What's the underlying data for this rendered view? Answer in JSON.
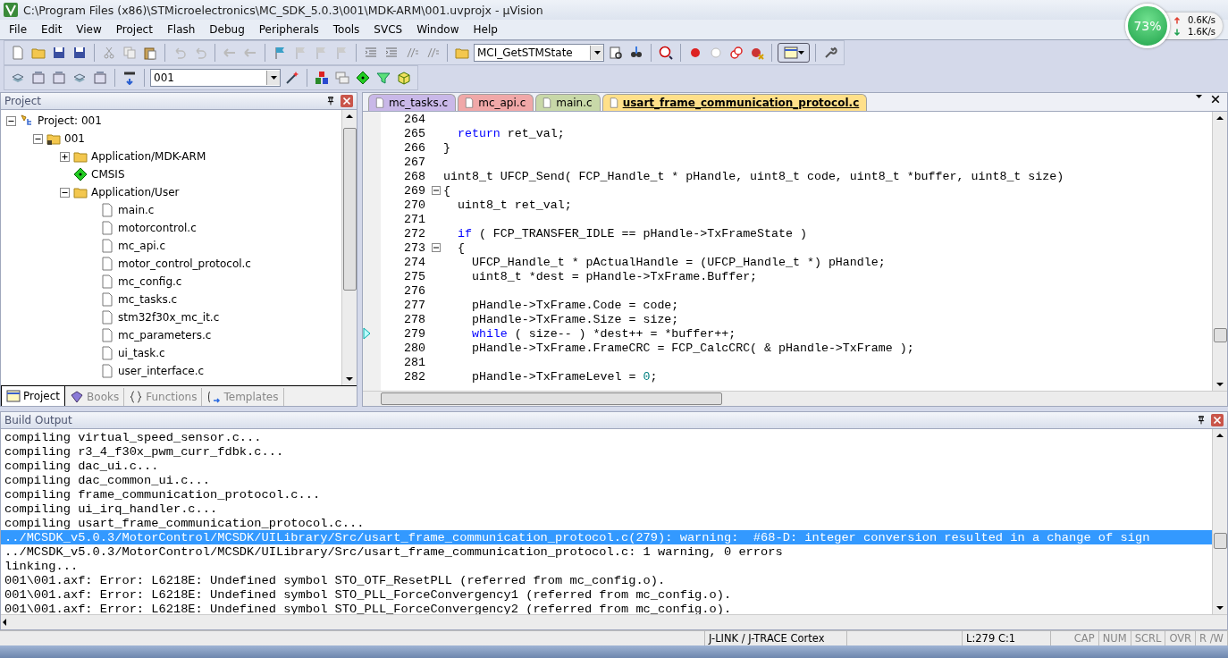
{
  "window": {
    "title": "C:\\Program Files (x86)\\STMicroelectronics\\MC_SDK_5.0.3\\001\\MDK-ARM\\001.uvprojx - µVision"
  },
  "net_monitor": {
    "cpu": "73%",
    "upload": "0.6K/s",
    "download": "1.6K/s"
  },
  "menu": [
    "File",
    "Edit",
    "View",
    "Project",
    "Flash",
    "Debug",
    "Peripherals",
    "Tools",
    "SVCS",
    "Window",
    "Help"
  ],
  "toolbar": {
    "function_combo": "MCI_GetSTMState",
    "target_combo": "001"
  },
  "project_panel": {
    "title": "Project",
    "tree": [
      {
        "label": "Project: 001",
        "kind": "project",
        "expanded": true,
        "children": [
          {
            "label": "001",
            "kind": "target",
            "expanded": true,
            "children": [
              {
                "label": "Application/MDK-ARM",
                "kind": "folder",
                "expanded": false
              },
              {
                "label": "CMSIS",
                "kind": "component"
              },
              {
                "label": "Application/User",
                "kind": "folder",
                "expanded": true,
                "children": [
                  {
                    "label": "main.c",
                    "kind": "file"
                  },
                  {
                    "label": "motorcontrol.c",
                    "kind": "file"
                  },
                  {
                    "label": "mc_api.c",
                    "kind": "file"
                  },
                  {
                    "label": "motor_control_protocol.c",
                    "kind": "file"
                  },
                  {
                    "label": "mc_config.c",
                    "kind": "file"
                  },
                  {
                    "label": "mc_tasks.c",
                    "kind": "file"
                  },
                  {
                    "label": "stm32f30x_mc_it.c",
                    "kind": "file"
                  },
                  {
                    "label": "mc_parameters.c",
                    "kind": "file"
                  },
                  {
                    "label": "ui_task.c",
                    "kind": "file"
                  },
                  {
                    "label": "user_interface.c",
                    "kind": "file"
                  }
                ]
              }
            ]
          }
        ]
      }
    ],
    "tabs": [
      {
        "label": "Project",
        "kind": "project",
        "selected": true
      },
      {
        "label": "Books",
        "kind": "books",
        "selected": false
      },
      {
        "label": "Functions",
        "kind": "functions",
        "selected": false
      },
      {
        "label": "Templates",
        "kind": "templates",
        "selected": false
      }
    ]
  },
  "editor": {
    "tabs": [
      {
        "label": "mc_tasks.c",
        "color": "#c9b8e8",
        "selected": false
      },
      {
        "label": "mc_api.c",
        "color": "#f0a8a8",
        "selected": false
      },
      {
        "label": "main.c",
        "color": "#c8d8a8",
        "selected": false
      },
      {
        "label": "usart_frame_communication_protocol.c",
        "color": "#ffe08a",
        "selected": true
      }
    ],
    "lines": [
      {
        "number": "264",
        "collapsible": false,
        "current": false
      },
      {
        "number": "265",
        "collapsible": false,
        "current": false,
        "segments": [
          {
            "kind": "keyword",
            "text": "  return"
          },
          {
            "kind": "plain",
            "text": " ret_val;"
          }
        ]
      },
      {
        "number": "266",
        "collapsible": false,
        "current": false,
        "segments": [
          {
            "kind": "plain",
            "text": "}"
          }
        ]
      },
      {
        "number": "267",
        "collapsible": false,
        "current": false
      },
      {
        "number": "268",
        "collapsible": false,
        "current": false,
        "segments": [
          {
            "kind": "plain",
            "text": "uint8_t UFCP_Send( FCP_Handle_t * pHandle, uint8_t code, uint8_t *buffer, uint8_t size)"
          }
        ]
      },
      {
        "number": "269",
        "collapsible": true,
        "current": false,
        "segments": [
          {
            "kind": "plain",
            "text": "{"
          }
        ]
      },
      {
        "number": "270",
        "collapsible": false,
        "current": false,
        "segments": [
          {
            "kind": "plain",
            "text": "  uint8_t ret_val;"
          }
        ]
      },
      {
        "number": "271",
        "collapsible": false,
        "current": false
      },
      {
        "number": "272",
        "collapsible": false,
        "current": false,
        "segments": [
          {
            "kind": "keyword",
            "text": "  if"
          },
          {
            "kind": "plain",
            "text": " ( FCP_TRANSFER_IDLE == pHandle->TxFrameState )"
          }
        ]
      },
      {
        "number": "273",
        "collapsible": true,
        "current": false,
        "segments": [
          {
            "kind": "plain",
            "text": "  {"
          }
        ]
      },
      {
        "number": "274",
        "collapsible": false,
        "current": false,
        "segments": [
          {
            "kind": "plain",
            "text": "    UFCP_Handle_t * pActualHandle = (UFCP_Handle_t *) pHandle;"
          }
        ]
      },
      {
        "number": "275",
        "collapsible": false,
        "current": false,
        "segments": [
          {
            "kind": "plain",
            "text": "    uint8_t *dest = pHandle->TxFrame.Buffer;"
          }
        ]
      },
      {
        "number": "276",
        "collapsible": false,
        "current": false
      },
      {
        "number": "277",
        "collapsible": false,
        "current": false,
        "segments": [
          {
            "kind": "plain",
            "text": "    pHandle->TxFrame.Code = code;"
          }
        ]
      },
      {
        "number": "278",
        "collapsible": false,
        "current": false,
        "segments": [
          {
            "kind": "plain",
            "text": "    pHandle->TxFrame.Size = size;"
          }
        ]
      },
      {
        "number": "279",
        "collapsible": false,
        "current": true,
        "segments": [
          {
            "kind": "keyword",
            "text": "    while"
          },
          {
            "kind": "plain",
            "text": " ( size-- ) *dest++ = *buffer++;"
          }
        ]
      },
      {
        "number": "280",
        "collapsible": false,
        "current": false,
        "segments": [
          {
            "kind": "plain",
            "text": "    pHandle->TxFrame.FrameCRC = FCP_CalcCRC( & pHandle->TxFrame );"
          }
        ]
      },
      {
        "number": "281",
        "collapsible": false,
        "current": false
      },
      {
        "number": "282",
        "collapsible": false,
        "current": false,
        "segments": [
          {
            "kind": "plain",
            "text": "    pHandle->TxFrameLevel = "
          },
          {
            "kind": "number",
            "text": "0"
          },
          {
            "kind": "plain",
            "text": ";"
          }
        ]
      }
    ]
  },
  "build_output": {
    "title": "Build Output",
    "lines": [
      {
        "text": "compiling virtual_speed_sensor.c...",
        "selected": false
      },
      {
        "text": "compiling r3_4_f30x_pwm_curr_fdbk.c...",
        "selected": false
      },
      {
        "text": "compiling dac_ui.c...",
        "selected": false
      },
      {
        "text": "compiling dac_common_ui.c...",
        "selected": false
      },
      {
        "text": "compiling frame_communication_protocol.c...",
        "selected": false
      },
      {
        "text": "compiling ui_irq_handler.c...",
        "selected": false
      },
      {
        "text": "compiling usart_frame_communication_protocol.c...",
        "selected": false
      },
      {
        "text": "../MCSDK_v5.0.3/MotorControl/MCSDK/UILibrary/Src/usart_frame_communication_protocol.c(279): warning:  #68-D: integer conversion resulted in a change of sign",
        "selected": true
      },
      {
        "text": "../MCSDK_v5.0.3/MotorControl/MCSDK/UILibrary/Src/usart_frame_communication_protocol.c: 1 warning, 0 errors",
        "selected": false
      },
      {
        "text": "linking...",
        "selected": false
      },
      {
        "text": "001\\001.axf: Error: L6218E: Undefined symbol STO_OTF_ResetPLL (referred from mc_config.o).",
        "selected": false
      },
      {
        "text": "001\\001.axf: Error: L6218E: Undefined symbol STO_PLL_ForceConvergency1 (referred from mc_config.o).",
        "selected": false
      },
      {
        "text": "001\\001.axf: Error: L6218E: Undefined symbol STO_PLL_ForceConvergency2 (referred from mc_config.o).",
        "selected": false
      }
    ]
  },
  "status_bar": {
    "debugger": "J-LINK / J-TRACE Cortex",
    "position": "L:279 C:1",
    "indicators": [
      "CAP",
      "NUM",
      "SCRL",
      "OVR",
      "R /W"
    ]
  }
}
